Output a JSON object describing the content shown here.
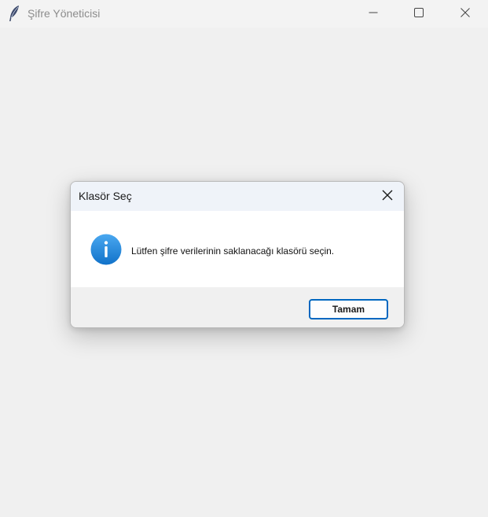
{
  "window": {
    "title": "Şifre Yöneticisi",
    "icon": "feather-icon",
    "controls": {
      "minimize_icon": "minimize-icon",
      "maximize_icon": "maximize-icon",
      "close_icon": "close-icon"
    }
  },
  "dialog": {
    "title": "Klasör Seç",
    "close_icon": "close-icon",
    "icon": "info-icon",
    "message": "Lütfen şifre verilerinin saklanacağı klasörü seçin.",
    "ok_label": "Tamam"
  },
  "colors": {
    "accent": "#0067c0",
    "info_blue": "#1e88e5",
    "window_bg": "#f0f0f0",
    "dialog_body_bg": "#ffffff"
  }
}
